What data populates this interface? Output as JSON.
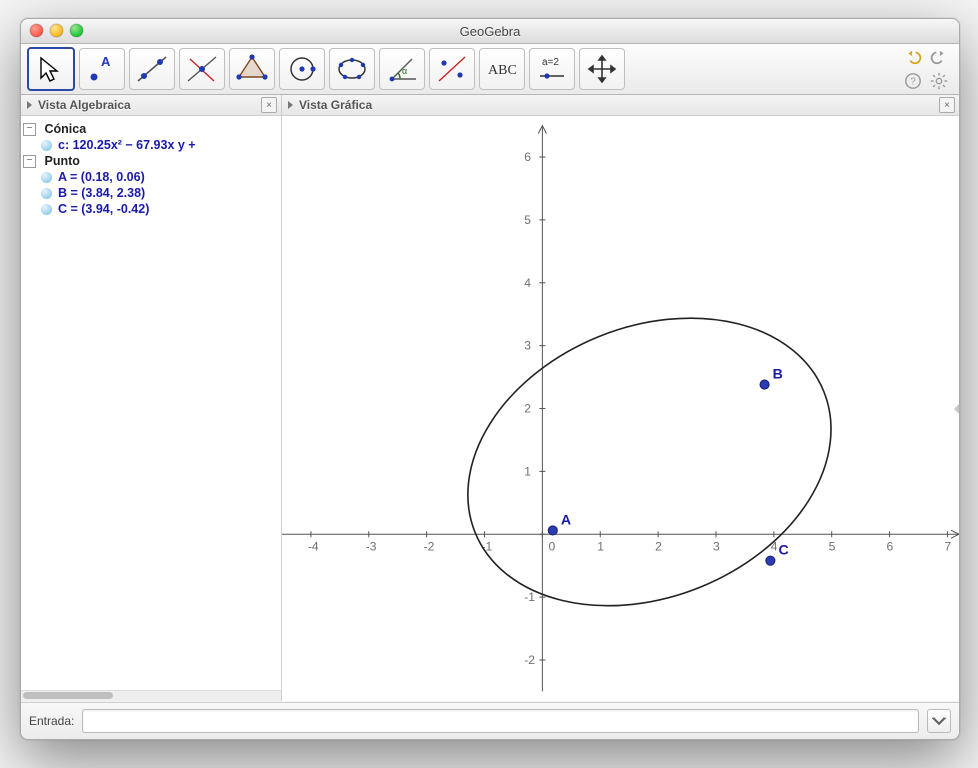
{
  "window": {
    "title": "GeoGebra"
  },
  "toolbar": {
    "tools": [
      {
        "id": "move",
        "sel": true
      },
      {
        "id": "point"
      },
      {
        "id": "line"
      },
      {
        "id": "perpendicular"
      },
      {
        "id": "polygon"
      },
      {
        "id": "circle"
      },
      {
        "id": "conic"
      },
      {
        "id": "angle"
      },
      {
        "id": "reflect"
      },
      {
        "id": "text"
      },
      {
        "id": "slider"
      },
      {
        "id": "move-view"
      }
    ],
    "text_tool_label": "ABC",
    "slider_tool_label": "a=2"
  },
  "panels": {
    "algebra": {
      "title": "Vista Algebraica"
    },
    "graphics": {
      "title": "Vista Gráfica"
    }
  },
  "algebra": {
    "groups": [
      {
        "name": "Cónica",
        "items": [
          {
            "name": "c",
            "def": "c: 120.25x² − 67.93x y +"
          }
        ]
      },
      {
        "name": "Punto",
        "items": [
          {
            "name": "A",
            "def": "A = (0.18, 0.06)"
          },
          {
            "name": "B",
            "def": "B = (3.84, 2.38)"
          },
          {
            "name": "C",
            "def": "C = (3.94, -0.42)"
          }
        ]
      }
    ]
  },
  "chart_data": {
    "type": "scatter",
    "title": "",
    "xlim": [
      -4.5,
      7.2
    ],
    "ylim": [
      -2.5,
      6.5
    ],
    "xticks": [
      -4,
      -3,
      -2,
      -1,
      0,
      1,
      2,
      3,
      4,
      5,
      6,
      7
    ],
    "yticks": [
      -2,
      -1,
      0,
      1,
      2,
      3,
      4,
      5,
      6
    ],
    "points": [
      {
        "name": "A",
        "x": 0.18,
        "y": 0.06
      },
      {
        "name": "B",
        "x": 3.84,
        "y": 2.38
      },
      {
        "name": "C",
        "x": 3.94,
        "y": -0.42
      }
    ],
    "ellipse": {
      "cx": 1.85,
      "cy": 1.15,
      "rx": 3.25,
      "ry": 2.15,
      "rot": 22
    }
  },
  "inputbar": {
    "label": "Entrada:",
    "value": ""
  }
}
